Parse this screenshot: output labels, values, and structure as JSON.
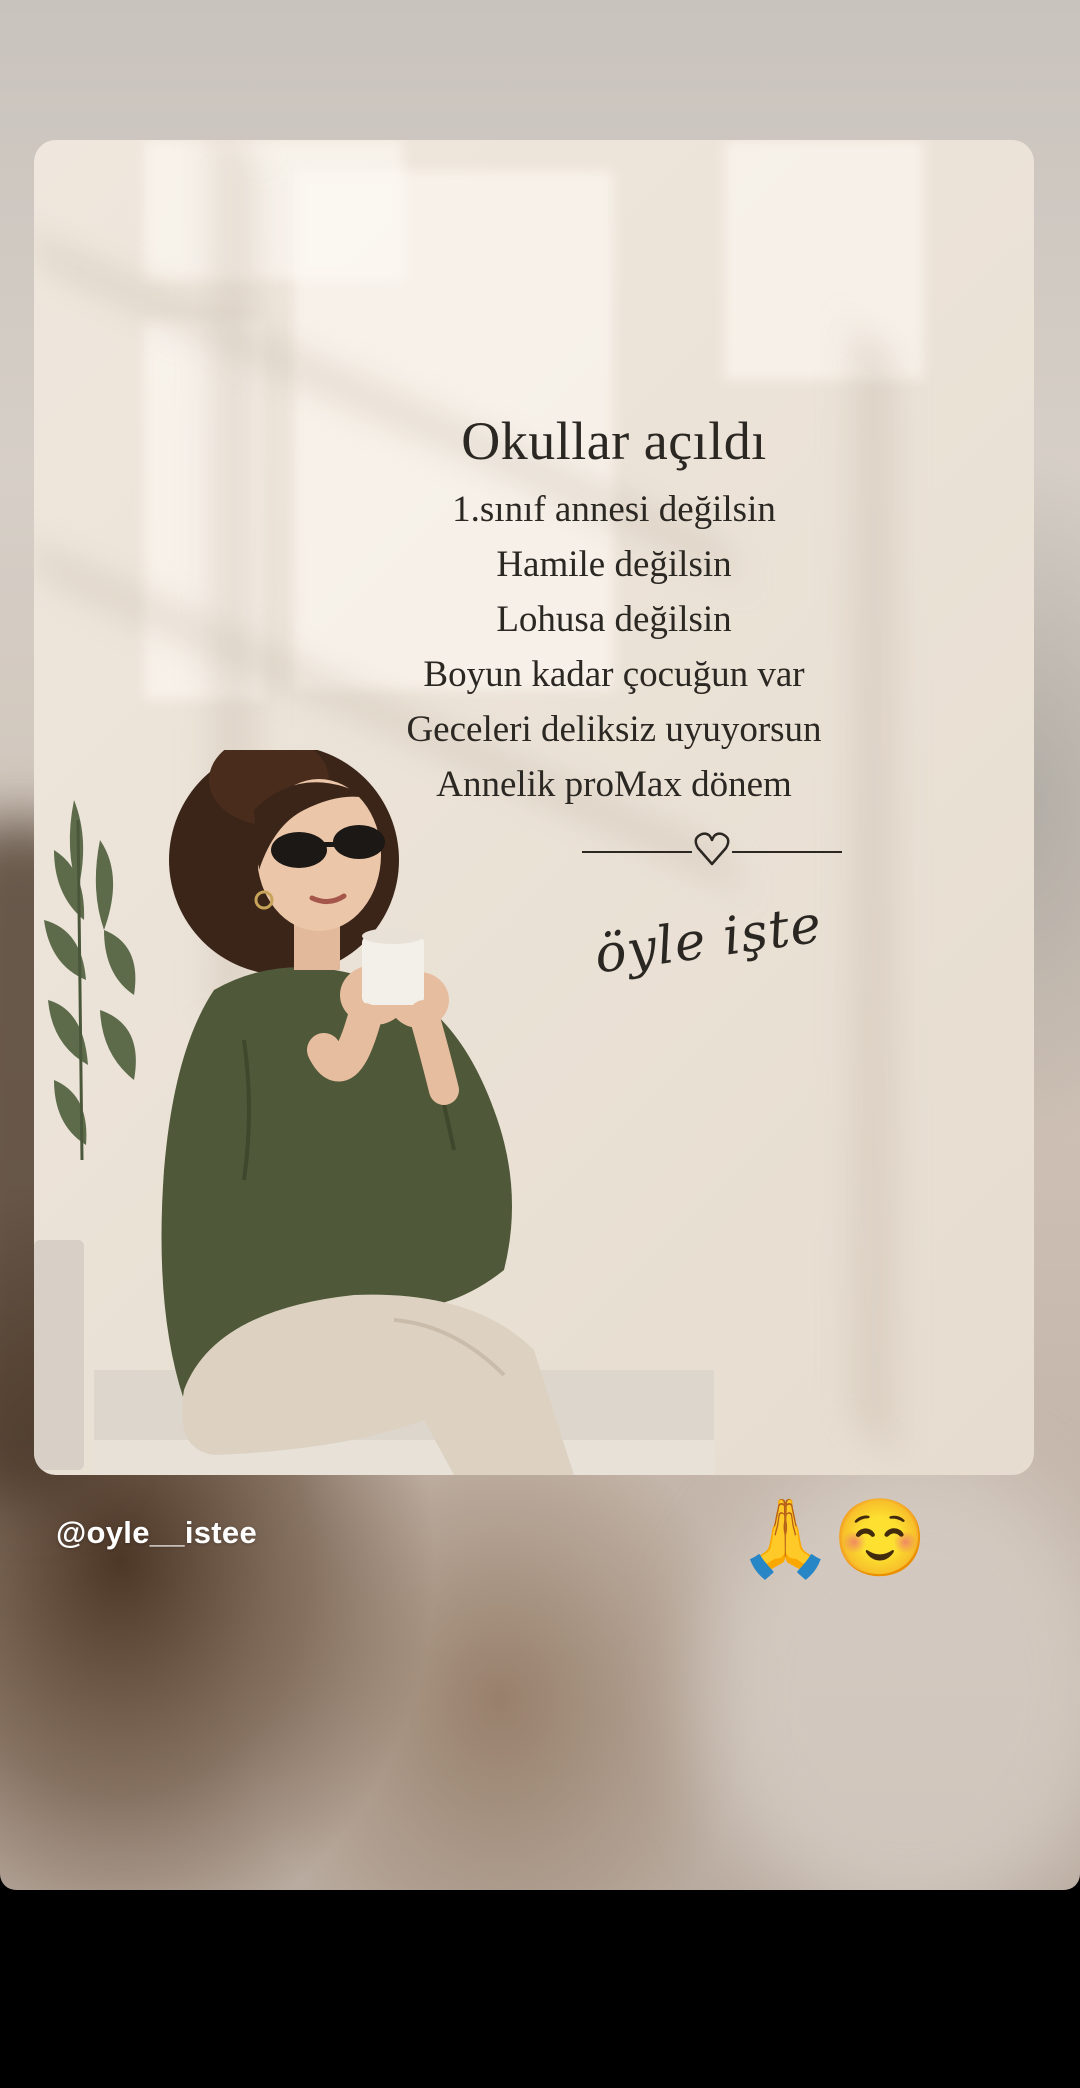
{
  "story": {
    "username": "@oyle__istee",
    "emoji_sticker": "🙏☺️"
  },
  "post": {
    "title": "Okullar açıldı",
    "lines": [
      "1.sınıf annesi değilsin",
      "Hamile değilsin",
      "Lohusa değilsin",
      "Boyun kadar çocuğun var",
      "Geceleri deliksiz uyuyorsun",
      "Annelik proMax dönem"
    ],
    "signature": "öyle işte",
    "divider_icon": "heart-icon"
  },
  "colors": {
    "card_background": "#ece3d8",
    "text": "#2b2722",
    "shirt": "#4f5838",
    "pants": "#ddd2c2"
  }
}
